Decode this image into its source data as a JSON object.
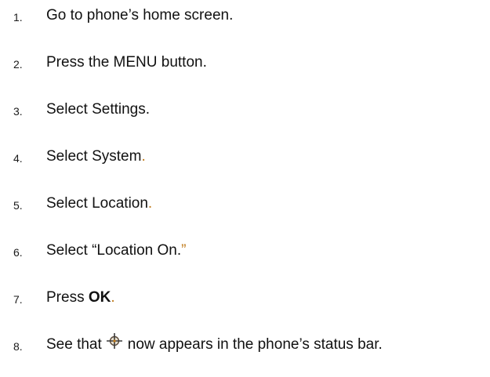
{
  "steps": [
    {
      "number": "1.",
      "text": "Go to phone’s home screen."
    },
    {
      "number": "2.",
      "text": "Press the MENU button."
    },
    {
      "number": "3.",
      "text": "Select Settings."
    },
    {
      "number": "4.",
      "text": "Select System",
      "end": "."
    },
    {
      "number": "5.",
      "text": "Select Location",
      "end": "."
    },
    {
      "number": "6.",
      "text": "Select “Location On.",
      "end": "”"
    },
    {
      "number": "7.",
      "prefix": "Press ",
      "bold": "OK",
      "end": "."
    },
    {
      "number": "8.",
      "prefix": "See that",
      "icon": "gps-location-icon",
      "suffix": "now appears in the phone’s status bar."
    }
  ],
  "colors": {
    "text": "#111111",
    "accent_punctuation": "#c07a1a"
  }
}
